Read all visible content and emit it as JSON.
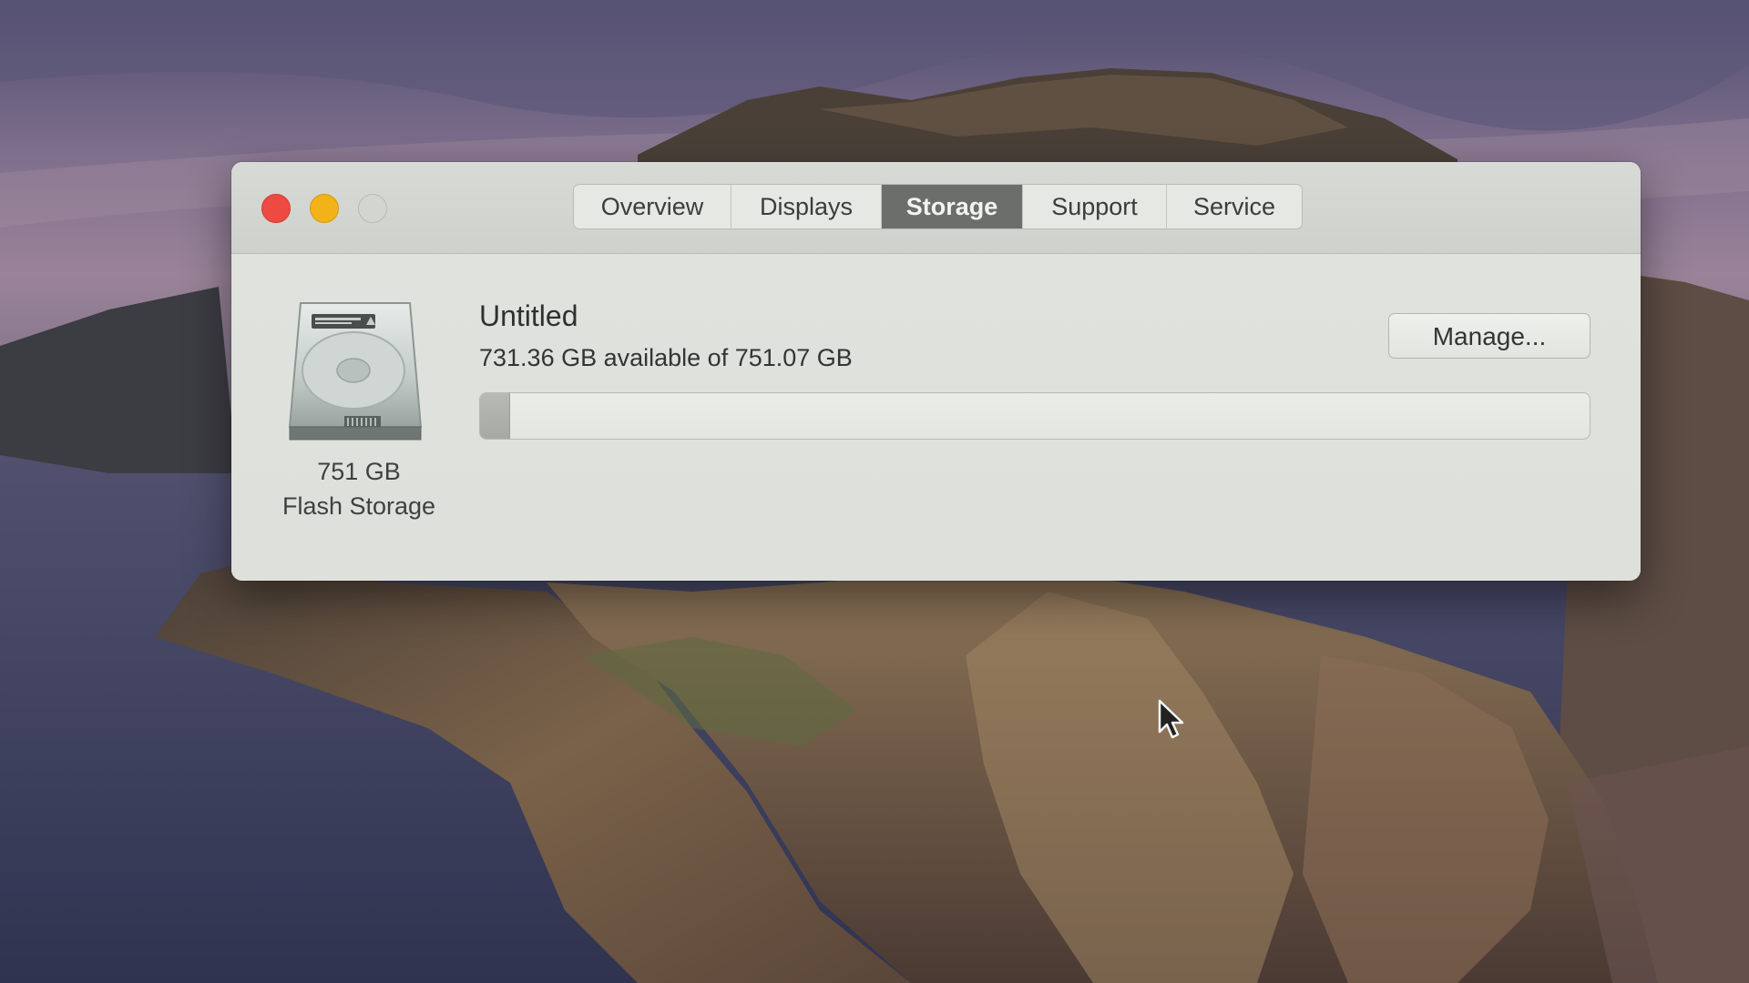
{
  "window": {
    "tabs": [
      {
        "label": "Overview",
        "active": false
      },
      {
        "label": "Displays",
        "active": false
      },
      {
        "label": "Storage",
        "active": true
      },
      {
        "label": "Support",
        "active": false
      },
      {
        "label": "Service",
        "active": false
      }
    ]
  },
  "storage": {
    "drive_icon": "hard-drive-icon",
    "drive_size": "751 GB",
    "drive_type": "Flash Storage",
    "volume_name": "Untitled",
    "availability": "731.36 GB available of 751.07 GB",
    "used_fraction": 0.026,
    "manage_label": "Manage..."
  },
  "colors": {
    "close": "#ee4a42",
    "minimize": "#f2b318",
    "maximize_inactive": "#d3d5d1",
    "active_tab": "#6c6e6c"
  }
}
